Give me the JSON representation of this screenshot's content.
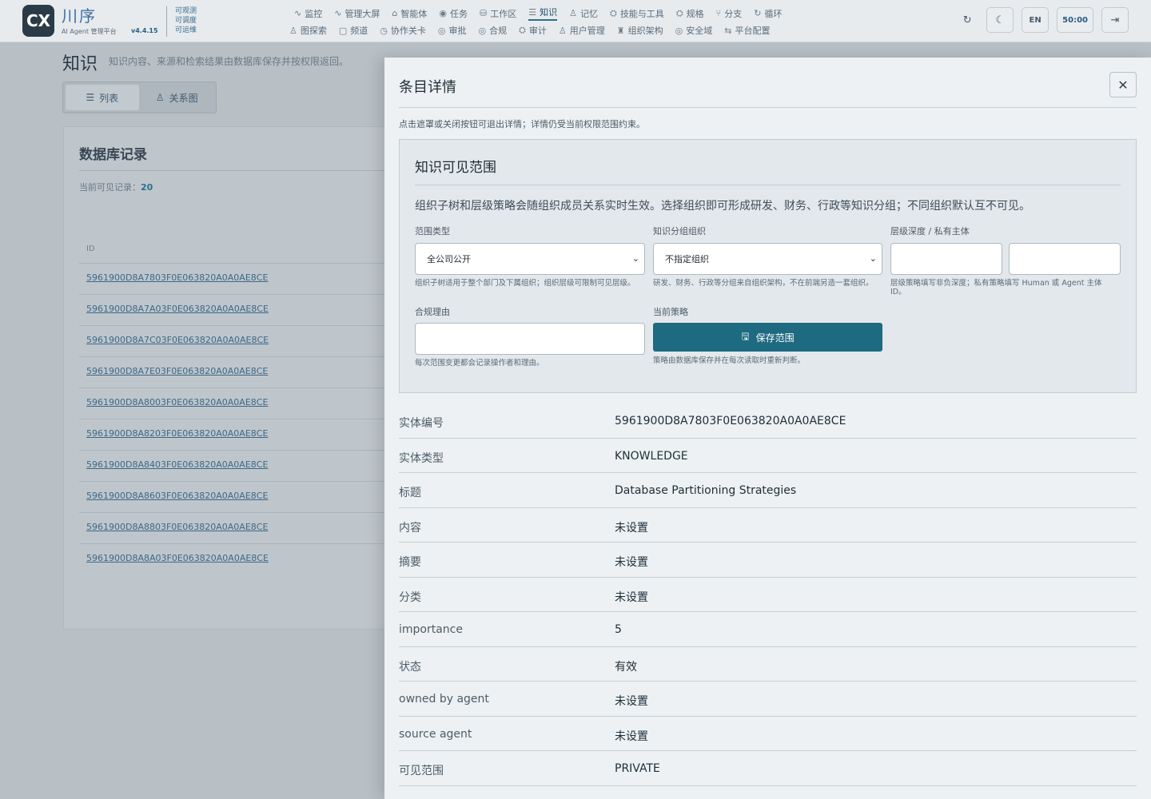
{
  "app": {
    "logo": "CX",
    "name": "川序",
    "subtitle": "AI Agent 管理平台",
    "version": "v4.4.15",
    "tags": [
      "可观测",
      "可调度",
      "可运维"
    ]
  },
  "nav": {
    "row1": [
      {
        "icon": "∿",
        "label": "监控"
      },
      {
        "icon": "∿",
        "label": "管理大屏"
      },
      {
        "icon": "⌂",
        "label": "智能体"
      },
      {
        "icon": "◉",
        "label": "任务"
      },
      {
        "icon": "⛁",
        "label": "工作区"
      },
      {
        "icon": "☰",
        "label": "知识"
      },
      {
        "icon": "♙",
        "label": "记忆"
      },
      {
        "icon": "⛭",
        "label": "技能与工具"
      },
      {
        "icon": "⛭",
        "label": "规格"
      },
      {
        "icon": "⑂",
        "label": "分支"
      },
      {
        "icon": "↻",
        "label": "循环"
      }
    ],
    "row2": [
      {
        "icon": "♙",
        "label": "图探索"
      },
      {
        "icon": "▢",
        "label": "频道"
      },
      {
        "icon": "◷",
        "label": "协作关卡"
      },
      {
        "icon": "◎",
        "label": "审批"
      },
      {
        "icon": "◎",
        "label": "合规"
      },
      {
        "icon": "⛭",
        "label": "审计"
      },
      {
        "icon": "♙",
        "label": "用户管理"
      },
      {
        "icon": "♜",
        "label": "组织架构"
      },
      {
        "icon": "◎",
        "label": "安全域"
      },
      {
        "icon": "⇆",
        "label": "平台配置"
      }
    ],
    "active_label": "知识"
  },
  "toolbar": {
    "refresh_icon": "↻",
    "theme_icon": "☾",
    "lang": "EN",
    "timer": "50:00",
    "logout_icon": "⇥"
  },
  "page": {
    "title": "知识",
    "description": "知识内容、来源和检索结果由数据库保存并按权限返回。",
    "tabs": [
      {
        "icon": "☰",
        "label": "列表"
      },
      {
        "icon": "♙",
        "label": "关系图"
      }
    ]
  },
  "records": {
    "title": "数据库记录",
    "count_label": "当前可见记录：",
    "count_value": "20",
    "column_header": "ID",
    "ids": [
      "5961900D8A7803F0E063820A0A0AE8CE",
      "5961900D8A7A03F0E063820A0A0AE8CE",
      "5961900D8A7C03F0E063820A0A0AE8CE",
      "5961900D8A7E03F0E063820A0A0AE8CE",
      "5961900D8A8003F0E063820A0A0AE8CE",
      "5961900D8A8203F0E063820A0A0AE8CE",
      "5961900D8A8403F0E063820A0A0AE8CE",
      "5961900D8A8603F0E063820A0A0AE8CE",
      "5961900D8A8803F0E063820A0A0AE8CE",
      "5961900D8A8A03F0E063820A0A0AE8CE"
    ]
  },
  "drawer": {
    "title": "条目详情",
    "close_icon": "✕",
    "hint": "点击遮罩或关闭按钮可退出详情；详情仍受当前权限范围约束。",
    "scope": {
      "title": "知识可见范围",
      "description": "组织子树和层级策略会随组织成员关系实时生效。选择组织即可形成研发、财务、行政等知识分组；不同组织默认互不可见。",
      "scope_type_label": "范围类型",
      "scope_type_value": "全公司公开",
      "scope_type_help": "组织子树适用于整个部门及下属组织；组织层级可限制可见层级。",
      "group_org_label": "知识分组组织",
      "group_org_value": "不指定组织",
      "group_org_help": "研发、财务、行政等分组来自组织架构，不在前端另造一套组织。",
      "depth_label": "层级深度 / 私有主体",
      "depth_help": "层级策略填写非负深度；私有策略填写 Human 或 Agent 主体 ID。",
      "reason_label": "合规理由",
      "reason_help": "每次范围变更都会记录操作者和理由。",
      "policy_label": "当前策略",
      "save_label": "保存范围",
      "policy_help": "策略由数据库保存并在每次读取时重新判断。"
    },
    "fields": [
      {
        "key": "实体编号",
        "value": "5961900D8A7803F0E063820A0A0AE8CE"
      },
      {
        "key": "实体类型",
        "value": "KNOWLEDGE"
      },
      {
        "key": "标题",
        "value": "Database Partitioning Strategies"
      },
      {
        "key": "内容",
        "value": "未设置"
      },
      {
        "key": "摘要",
        "value": "未设置"
      },
      {
        "key": "分类",
        "value": "未设置"
      },
      {
        "key": "importance",
        "value": "5"
      },
      {
        "key": "状态",
        "value": "有效"
      },
      {
        "key": "owned by agent",
        "value": "未设置"
      },
      {
        "key": "source agent",
        "value": "未设置"
      },
      {
        "key": "可见范围",
        "value": "PRIVATE"
      }
    ]
  },
  "colors": {
    "primary": "#1e6a80",
    "overlay": "#b8c0c6",
    "drawer_bg": "#edf1f3",
    "link": "#3d6887"
  }
}
